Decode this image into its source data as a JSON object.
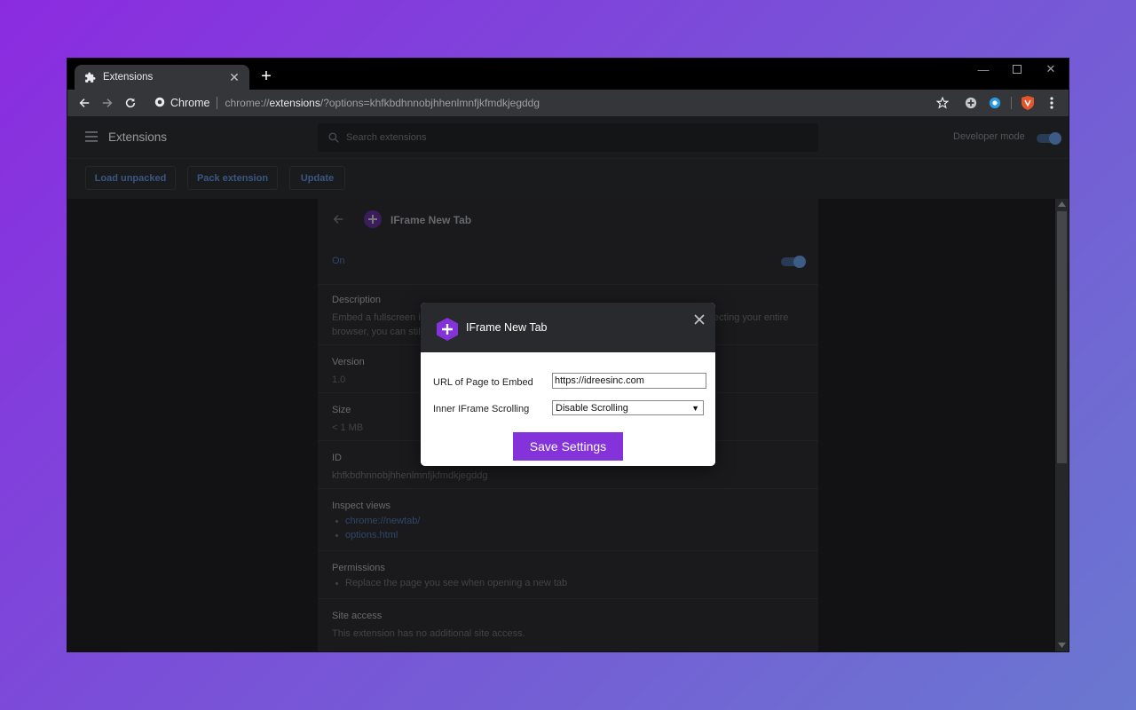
{
  "browser": {
    "tab_title": "Extensions",
    "new_tab_symbol": "+",
    "chrome_label": "Chrome",
    "url_scheme": "chrome://",
    "url_path": "extensions",
    "url_query": "/?options=khfkbdhnnobjhhenlmnfjkfmdkjegddg"
  },
  "extensions_page": {
    "title": "Extensions",
    "search_placeholder": "Search extensions",
    "developer_mode_label": "Developer mode",
    "developer_mode": true,
    "actions": [
      "Load unpacked",
      "Pack extension",
      "Update"
    ]
  },
  "detail": {
    "name": "IFrame New Tab",
    "on_label": "On",
    "enabled": true,
    "description_heading": "Description",
    "description_line1": "Embed a fullscreen if",
    "description_line1_end": "ecting your entire",
    "description_line2": "browser, you can still",
    "version_heading": "Version",
    "version": "1.0",
    "size_heading": "Size",
    "size": "< 1 MB",
    "id_heading": "ID",
    "id": "khfkbdhnnobjhhenlmnfjkfmdkjegddg",
    "inspect_heading": "Inspect views",
    "inspect_views": [
      "chrome://newtab/",
      "options.html"
    ],
    "permissions_heading": "Permissions",
    "permissions": [
      "Replace the page you see when opening a new tab"
    ],
    "site_access_heading": "Site access",
    "site_access": "This extension has no additional site access."
  },
  "dialog": {
    "title": "IFrame New Tab",
    "url_label": "URL of Page to Embed",
    "url_value": "https://idreesinc.com",
    "scrolling_label": "Inner IFrame Scrolling",
    "scrolling_value": "Disable Scrolling",
    "save_label": "Save Settings"
  },
  "colors": {
    "accent": "#8432d9",
    "link": "#4a6a9e",
    "toggle": "#5e8ccf"
  }
}
